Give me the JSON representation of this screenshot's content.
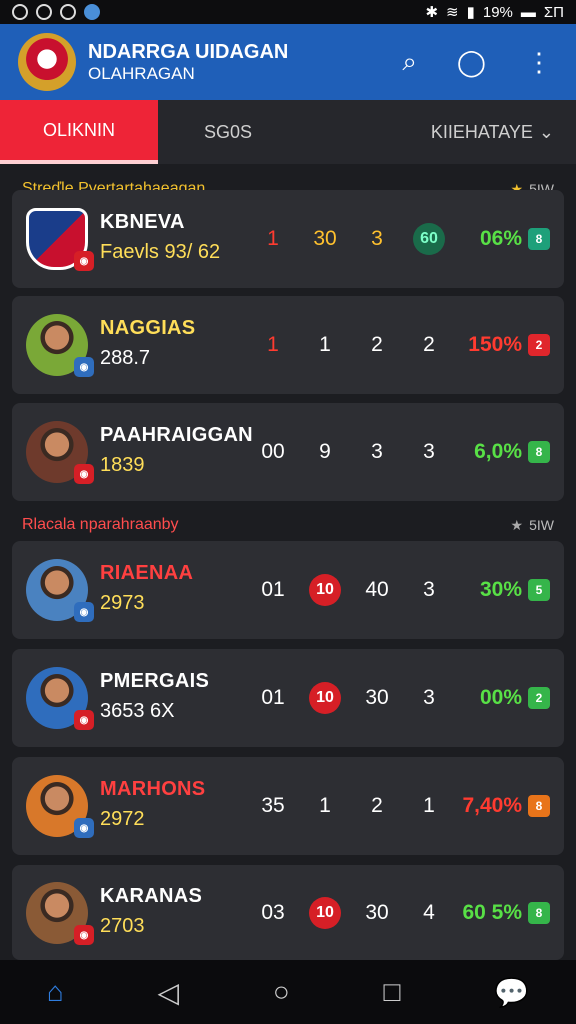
{
  "status": {
    "left_icons": [
      "sim-icon",
      "whatsapp-icon",
      "chrome-icon"
    ],
    "right": "19%",
    "time": "ΣΠ"
  },
  "app": {
    "title": "NDARRGA UIDAGAN",
    "subtitle": "OLAHRAGAN"
  },
  "tabs": {
    "active": "OLIKNIN",
    "second": "SG0S",
    "third": "KIIEHATAYE"
  },
  "sections": [
    {
      "title": "Streďle Pyertartahaeagan",
      "right": "5IW",
      "star_color": "#f2c12e",
      "title_color": "#f2c12e"
    },
    {
      "title": "Rlacala nparahraanby",
      "right": "5IW",
      "star_color": "#aaa",
      "title_color": "#ff4d4d"
    }
  ],
  "rows": [
    {
      "name": "KBNEVA",
      "value": "Faevls 93/ 62",
      "stats": [
        "1",
        "30",
        "3",
        "60"
      ],
      "stat_colors": [
        "#ff3b30",
        "#ffc12e",
        "#ffc12e",
        "#1fbf8c"
      ],
      "pct": "06%",
      "pct_color": "#58e046",
      "tag": "8",
      "tag_color": "#1ea07a",
      "name_color": "#fff",
      "value_color": "#ffde59",
      "circle_index": 3,
      "circle_color": "#1a6b4a"
    },
    {
      "name": "NAGGIAS",
      "value": "288.7",
      "stats": [
        "1",
        "1",
        "2",
        "2"
      ],
      "stat_colors": [
        "#ff3b30",
        "#fff",
        "#fff",
        "#fff"
      ],
      "pct": "150%",
      "pct_color": "#ff3b30",
      "tag": "2",
      "tag_color": "#e0262c",
      "name_color": "#ffde59",
      "value_color": "#fff",
      "circle_index": -1,
      "circle_color": ""
    },
    {
      "name": "PAAHRAIGGAN",
      "value": "1839",
      "stats": [
        "00",
        "9",
        "3",
        "3"
      ],
      "stat_colors": [
        "#fff",
        "#fff",
        "#fff",
        "#fff"
      ],
      "pct": "6,0%",
      "pct_color": "#58e046",
      "tag": "8",
      "tag_color": "#35b54a",
      "name_color": "#fff",
      "value_color": "#ffde59",
      "circle_index": -1,
      "circle_color": ""
    },
    {
      "name": "RIAENAA",
      "value": "2973",
      "stats": [
        "01",
        "10",
        "40",
        "3"
      ],
      "stat_colors": [
        "#fff",
        "#fff",
        "#fff",
        "#fff"
      ],
      "pct": "30%",
      "pct_color": "#58e046",
      "tag": "5",
      "tag_color": "#35b54a",
      "name_color": "#ff4040",
      "value_color": "#ffde59",
      "circle_index": 1,
      "circle_color": "#d61f26"
    },
    {
      "name": "PMERGAIS",
      "value": "3653 6X",
      "stats": [
        "01",
        "10",
        "30",
        "3"
      ],
      "stat_colors": [
        "#fff",
        "#fff",
        "#fff",
        "#fff"
      ],
      "pct": "00%",
      "pct_color": "#58e046",
      "tag": "2",
      "tag_color": "#35b54a",
      "name_color": "#fff",
      "value_color": "#fff",
      "circle_index": 1,
      "circle_color": "#d61f26"
    },
    {
      "name": "MARHONS",
      "value": "2972",
      "stats": [
        "35",
        "1",
        "2",
        "1"
      ],
      "stat_colors": [
        "#fff",
        "#fff",
        "#fff",
        "#fff"
      ],
      "pct": "7,40%",
      "pct_color": "#ff3b30",
      "tag": "8",
      "tag_color": "#e8741a",
      "name_color": "#ff4040",
      "value_color": "#ffde59",
      "circle_index": -1,
      "circle_color": ""
    },
    {
      "name": "KARANAS",
      "value": "2703",
      "stats": [
        "03",
        "10",
        "30",
        "4"
      ],
      "stat_colors": [
        "#fff",
        "#fff",
        "#fff",
        "#fff"
      ],
      "pct": "60 5%",
      "pct_color": "#58e046",
      "tag": "8",
      "tag_color": "#35b54a",
      "name_color": "#fff",
      "value_color": "#ffde59",
      "circle_index": 1,
      "circle_color": "#d61f26"
    }
  ],
  "avatar_colors": [
    "#b8281f",
    "#7aa837",
    "#6e3a2c",
    "#4a82c0",
    "#2f6dbd",
    "#d8782a",
    "#8a5a36"
  ],
  "nav": {
    "items": [
      "home-icon",
      "back-icon",
      "home-circle-icon",
      "recents-icon",
      "chat-icon"
    ]
  }
}
